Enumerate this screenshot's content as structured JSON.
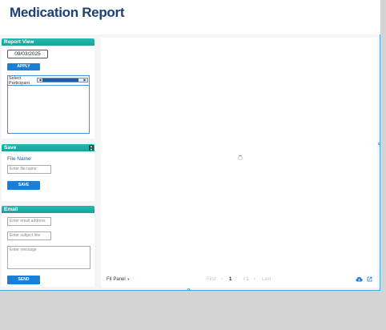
{
  "header": {
    "title": "Medication Report"
  },
  "report_view": {
    "title": "Report View",
    "date": "09/03/2025",
    "apply_label": "APPLY",
    "participant_label_line1": "Select",
    "participant_label_line2": "Participant"
  },
  "save": {
    "title": "Save",
    "file_name_label": "File Name",
    "file_name_placeholder": "Enter file name",
    "save_label": "SAVE"
  },
  "email": {
    "title": "Email",
    "address_placeholder": "Enter email address",
    "subject_placeholder": "Enter subject line",
    "message_placeholder": "Enter message",
    "send_label": "SEND"
  },
  "viewer": {
    "fit_label": "Fit Panel",
    "first_label": "First",
    "prev_symbol": "‹",
    "page_number": "1",
    "total_pages": "/ 1",
    "next_symbol": "›",
    "last_label": "Last"
  },
  "colors": {
    "accent": "#1a7fd6",
    "panel_header": "#1aa9a0",
    "title": "#1c3f74"
  }
}
